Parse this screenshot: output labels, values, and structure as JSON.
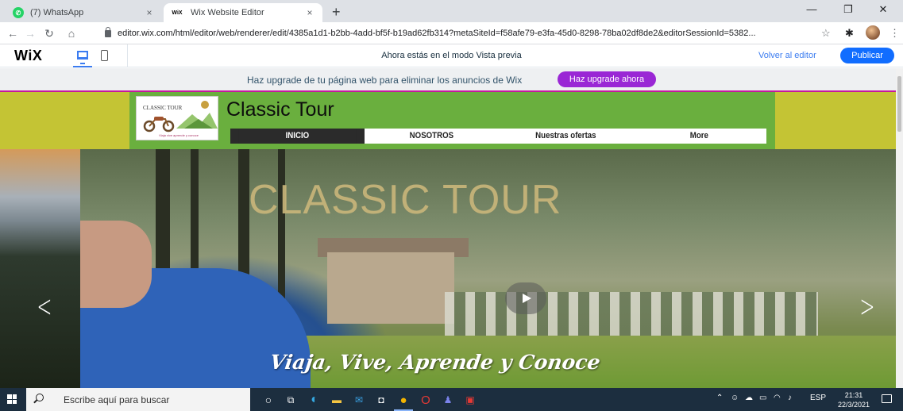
{
  "browser": {
    "tabs": [
      {
        "title": "(7) WhatsApp",
        "favicon": "whatsapp-icon",
        "close": "×"
      },
      {
        "title": "Wix Website Editor",
        "favicon": "wix-icon",
        "close": "×"
      }
    ],
    "new_tab": "+",
    "url": "editor.wix.com/html/editor/web/renderer/edit/4385a1d1-b2bb-4add-bf5f-b19ad62fb314?metaSiteId=f58afe79-e3fa-45d0-8298-78ba02df8de2&editorSessionId=5382..."
  },
  "wix_bar": {
    "logo": "WiX",
    "mode_text": "Ahora estás en el modo Vista previa",
    "back_label": "Volver al editor",
    "publish_label": "Publicar",
    "accent_color": "#116dff"
  },
  "upgrade_banner": {
    "text": "Haz upgrade de tu página web para eliminar los anuncios de Wix",
    "button_label": "Haz upgrade ahora",
    "button_color": "#9a27d5"
  },
  "site": {
    "logo_text": "CLASSIC TOUR",
    "logo_sub": "Viaja vive aprende y conoce",
    "title": "Classic Tour",
    "nav": [
      {
        "label": "INICIO",
        "active": true
      },
      {
        "label": "NOSOTROS",
        "active": false
      },
      {
        "label": "Nuestras ofertas",
        "active": false
      },
      {
        "label": "More",
        "active": false
      }
    ],
    "header_bg": "#6aaf3e",
    "header_outer_bg": "#c4c434"
  },
  "hero": {
    "title": "CLASSIC TOUR",
    "tagline": "Viaja, Vive, Aprende y Conoce",
    "prev_arrow": "<",
    "next_arrow": ">"
  },
  "taskbar": {
    "search_placeholder": "Escribe aquí para buscar",
    "language": "ESP",
    "time": "21:31",
    "date": "22/3/2021"
  }
}
